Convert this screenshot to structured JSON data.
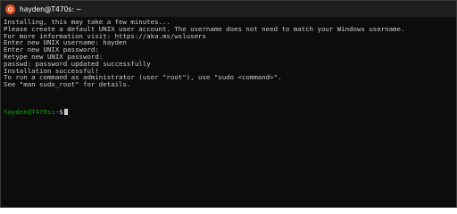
{
  "window": {
    "title": "hayden@T470s: ~",
    "icon": "ubuntu-icon"
  },
  "terminal": {
    "lines": [
      "Installing, this may take a few minutes...",
      "Please create a default UNIX user account. The username does not need to match your Windows username.",
      "For more information visit: https://aka.ms/wslusers",
      "Enter new UNIX username: hayden",
      "Enter new UNIX password:",
      "Retype new UNIX password:",
      "passwd: password updated successfully",
      "Installation successful!",
      "To run a command as administrator (user \"root\"), use \"sudo <command>\".",
      "See \"man sudo_root\" for details."
    ],
    "prompt": {
      "user_host": "hayden@T470s",
      "separator": ":",
      "path": "~",
      "symbol": "$"
    }
  },
  "colors": {
    "background": "#0c0c0c",
    "text": "#cccccc",
    "prompt_user": "#13a10e",
    "prompt_path": "#3b78ff",
    "icon": "#e95420"
  }
}
